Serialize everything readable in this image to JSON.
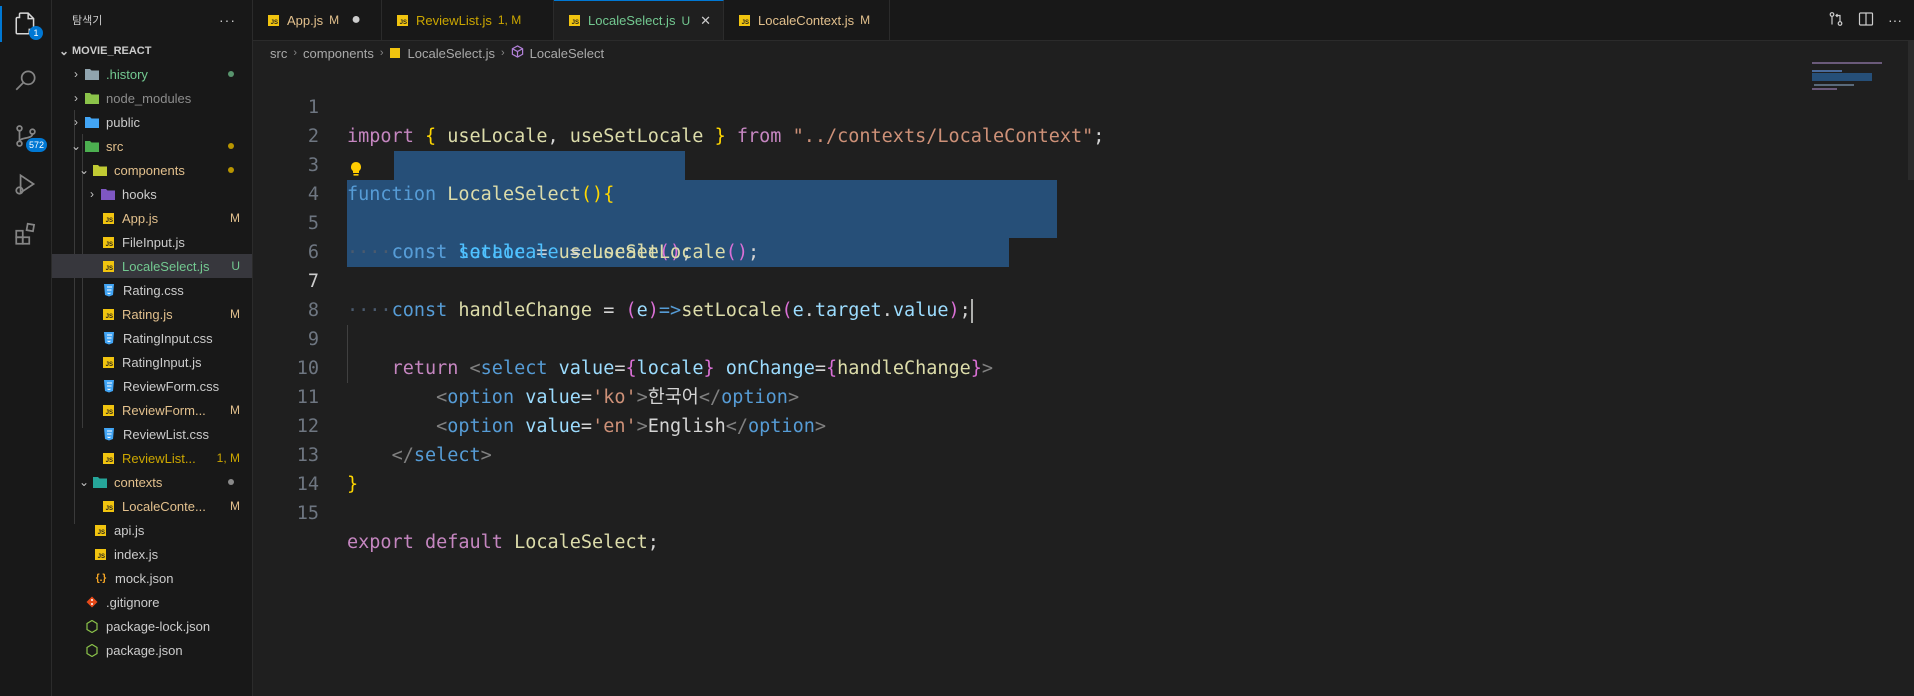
{
  "activity": {
    "explorer_badge": "1",
    "scm_badge": "572"
  },
  "sidebar": {
    "title": "탐색기",
    "more": "···",
    "project": "MOVIE_REACT",
    "items": [
      {
        "name": ".history",
        "status": ""
      },
      {
        "name": "node_modules",
        "status": ""
      },
      {
        "name": "public",
        "status": ""
      },
      {
        "name": "src",
        "status": ""
      },
      {
        "name": "components",
        "status": ""
      },
      {
        "name": "hooks",
        "status": ""
      },
      {
        "name": "App.js",
        "status": "M"
      },
      {
        "name": "FileInput.js",
        "status": ""
      },
      {
        "name": "LocaleSelect.js",
        "status": "U"
      },
      {
        "name": "Rating.css",
        "status": ""
      },
      {
        "name": "Rating.js",
        "status": "M"
      },
      {
        "name": "RatingInput.css",
        "status": ""
      },
      {
        "name": "RatingInput.js",
        "status": ""
      },
      {
        "name": "ReviewForm.css",
        "status": ""
      },
      {
        "name": "ReviewForm...",
        "status": "M"
      },
      {
        "name": "ReviewList.css",
        "status": ""
      },
      {
        "name": "ReviewList...",
        "status": "1, M"
      },
      {
        "name": "contexts",
        "status": ""
      },
      {
        "name": "LocaleConte...",
        "status": "M"
      },
      {
        "name": "api.js",
        "status": ""
      },
      {
        "name": "index.js",
        "status": ""
      },
      {
        "name": "mock.json",
        "status": ""
      },
      {
        "name": ".gitignore",
        "status": ""
      },
      {
        "name": "package-lock.json",
        "status": ""
      },
      {
        "name": "package.json",
        "status": ""
      }
    ]
  },
  "tabs": [
    {
      "name": "App.js",
      "status": "M"
    },
    {
      "name": "ReviewList.js",
      "status": "1, M"
    },
    {
      "name": "LocaleSelect.js",
      "status": "U"
    },
    {
      "name": "LocaleContext.js",
      "status": "M"
    }
  ],
  "breadcrumb": [
    "src",
    "components",
    "LocaleSelect.js",
    "LocaleSelect"
  ],
  "editor": {
    "line_numbers": [
      "1",
      "2",
      "3",
      "4",
      "5",
      "6",
      "7",
      "8",
      "9",
      "10",
      "11",
      "12",
      "13",
      "14",
      "15"
    ],
    "tokens": {
      "import": "import",
      "from": "from",
      "path": "\"../contexts/LocaleContext\"",
      "useLocale": "useLocale",
      "useSetLocale": "useSetLocale",
      "function": "function",
      "LocaleSelect": "LocaleSelect",
      "const": "const",
      "locale": "locale",
      "setLocale": "setLocale",
      "handleChange": "handleChange",
      "e": "e",
      "target": "target",
      "value": "value",
      "return": "return",
      "select": "select",
      "onChange": "onChange",
      "option": "option",
      "ko": "'ko'",
      "en": "'en'",
      "korean": "한국어",
      "english": "English",
      "export": "export",
      "default": "default"
    }
  },
  "colors": {
    "accent": "#0078d4",
    "modified": "#e2c08d",
    "untracked": "#73c991",
    "selection": "#264f78"
  }
}
